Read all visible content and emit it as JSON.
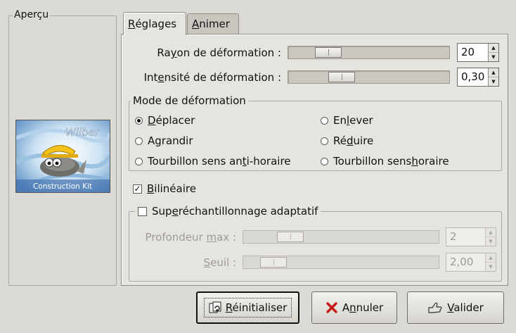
{
  "preview": {
    "title": "Aperçu",
    "image_text": "Wilber",
    "image_caption": "Construction Kit"
  },
  "tabs": {
    "settings": {
      "pre": "",
      "key": "R",
      "post": "églages"
    },
    "animate": {
      "pre": "",
      "key": "A",
      "post": "nimer"
    }
  },
  "radius": {
    "label_pre": "Ra",
    "label_key": "y",
    "label_post": "on de déformation :",
    "value": "20",
    "level": 0.2
  },
  "intensity": {
    "label_pre": "Int",
    "label_key": "e",
    "label_post": "nsité de déformation :",
    "value": "0,30",
    "level": 0.3
  },
  "mode": {
    "legend": "Mode de déformation",
    "options": [
      {
        "pre": "",
        "key": "D",
        "post": "éplacer",
        "selected": true
      },
      {
        "pre": "En",
        "key": "l",
        "post": "ever",
        "selected": false
      },
      {
        "pre": "A",
        "key": "g",
        "post": "randir",
        "selected": false
      },
      {
        "pre": "Ré",
        "key": "d",
        "post": "uire",
        "selected": false
      },
      {
        "pre": "Tourbillon sens an",
        "key": "t",
        "post": "i-horaire",
        "selected": false
      },
      {
        "pre": "Tourbillon sens ",
        "key": "h",
        "post": "oraire",
        "selected": false
      }
    ]
  },
  "bilinear": {
    "pre": "",
    "key": "B",
    "post": "ilinéaire",
    "checked": true,
    "check_glyph": "✓"
  },
  "supersampling": {
    "pre": "Sup",
    "key": "e",
    "post": "réchantillonnage adaptatif",
    "checked": false,
    "max_depth": {
      "pre": "Profondeur ",
      "key": "m",
      "post": "ax :",
      "value": "2",
      "level": 0.2
    },
    "threshold": {
      "pre": "",
      "key": "S",
      "post": "euil :",
      "value": "2,00",
      "level": 0.1
    }
  },
  "buttons": {
    "reset": {
      "pre": "",
      "key": "R",
      "post": "éinitialiser"
    },
    "cancel": {
      "pre": "A",
      "key": "n",
      "post": "nuler"
    },
    "ok": {
      "pre": "",
      "key": "V",
      "post": "alider"
    }
  },
  "spin_glyphs": {
    "up": "▲",
    "down": "▼"
  }
}
